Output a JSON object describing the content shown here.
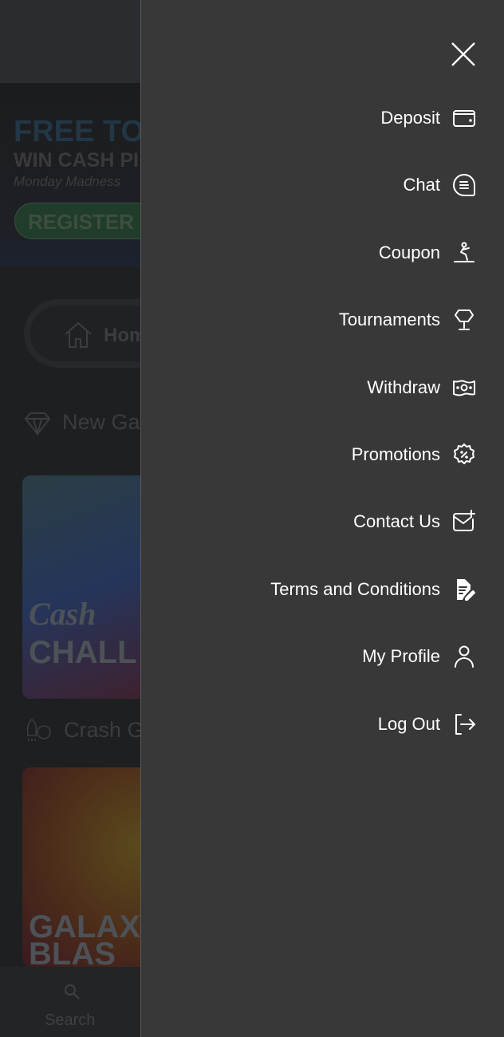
{
  "background": {
    "banner": {
      "line1": "FREE TO",
      "line2": "WIN CASH PI",
      "line3": "Monday Madness",
      "register": "REGISTER"
    },
    "home_tab": "Hom",
    "sections": [
      {
        "label": "New Ga",
        "icon": "diamond-icon"
      },
      {
        "label": "Crash G",
        "icon": "rocket-dollar-icon"
      }
    ],
    "cards": [
      {
        "title1": "Cash",
        "title2": "CHALL"
      },
      {
        "title1": "GALAX",
        "title2": "BLAS"
      }
    ],
    "bottom_nav": {
      "search": "Search"
    }
  },
  "drawer": {
    "close_icon": "close-icon",
    "items": [
      {
        "label": "Deposit",
        "icon": "wallet-icon"
      },
      {
        "label": "Chat",
        "icon": "chat-icon"
      },
      {
        "label": "Coupon",
        "icon": "coupon-icon"
      },
      {
        "label": "Tournaments",
        "icon": "trophy-icon"
      },
      {
        "label": "Withdraw",
        "icon": "money-icon"
      },
      {
        "label": "Promotions",
        "icon": "discount-badge-icon"
      },
      {
        "label": "Contact Us",
        "icon": "mail-plus-icon"
      },
      {
        "label": "Terms and Conditions",
        "icon": "document-edit-icon"
      },
      {
        "label": "My Profile",
        "icon": "user-icon"
      },
      {
        "label": "Log Out",
        "icon": "logout-icon"
      }
    ]
  },
  "colors": {
    "drawer_bg": "#383838",
    "text": "#ffffff",
    "overlay": "#1d1f21"
  }
}
